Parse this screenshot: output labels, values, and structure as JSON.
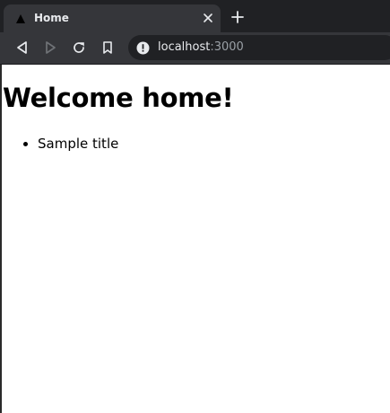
{
  "browser": {
    "tab": {
      "title": "Home",
      "favicon": "triangle-favicon-icon",
      "close_icon": "close-icon"
    },
    "new_tab_icon": "plus-icon",
    "toolbar": {
      "back_icon": "back-arrow-icon",
      "forward_icon": "forward-arrow-icon",
      "reload_icon": "reload-icon",
      "bookmark_icon": "bookmark-icon"
    },
    "omnibox": {
      "site_info_icon": "info-icon",
      "host": "localhost",
      "port": ":3000"
    },
    "colors": {
      "tabstrip": "#202124",
      "toolbar": "#35363a",
      "text": "#e8eaed",
      "muted": "#9aa0a6"
    }
  },
  "page": {
    "heading": "Welcome home!",
    "items": [
      "Sample title"
    ]
  }
}
